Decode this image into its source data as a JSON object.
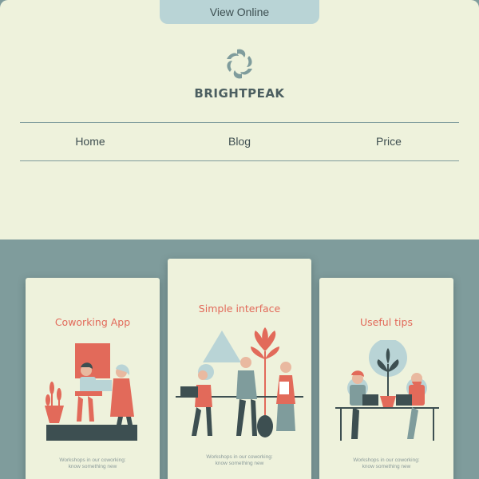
{
  "header": {
    "view_online": "View Online",
    "brand": "BRIGHTPEAK"
  },
  "nav": {
    "items": [
      {
        "label": "Home"
      },
      {
        "label": "Blog"
      },
      {
        "label": "Price"
      }
    ]
  },
  "cards": [
    {
      "title": "Coworking App",
      "caption_line1": "Workshops in our coworking:",
      "caption_line2": "know something new"
    },
    {
      "title": "Simple interface",
      "caption_line1": "Workshops in our coworking:",
      "caption_line2": "know something new"
    },
    {
      "title": "Useful tips",
      "caption_line1": "Workshops in our coworking:",
      "caption_line2": "know something new"
    }
  ],
  "colors": {
    "cream": "#eef2dc",
    "teal": "#7f9c9c",
    "light_teal": "#b9d4d6",
    "coral": "#e26a5a",
    "dark": "#3d4f51"
  },
  "icons": {
    "logo": "brightpeak-swirl-icon"
  }
}
